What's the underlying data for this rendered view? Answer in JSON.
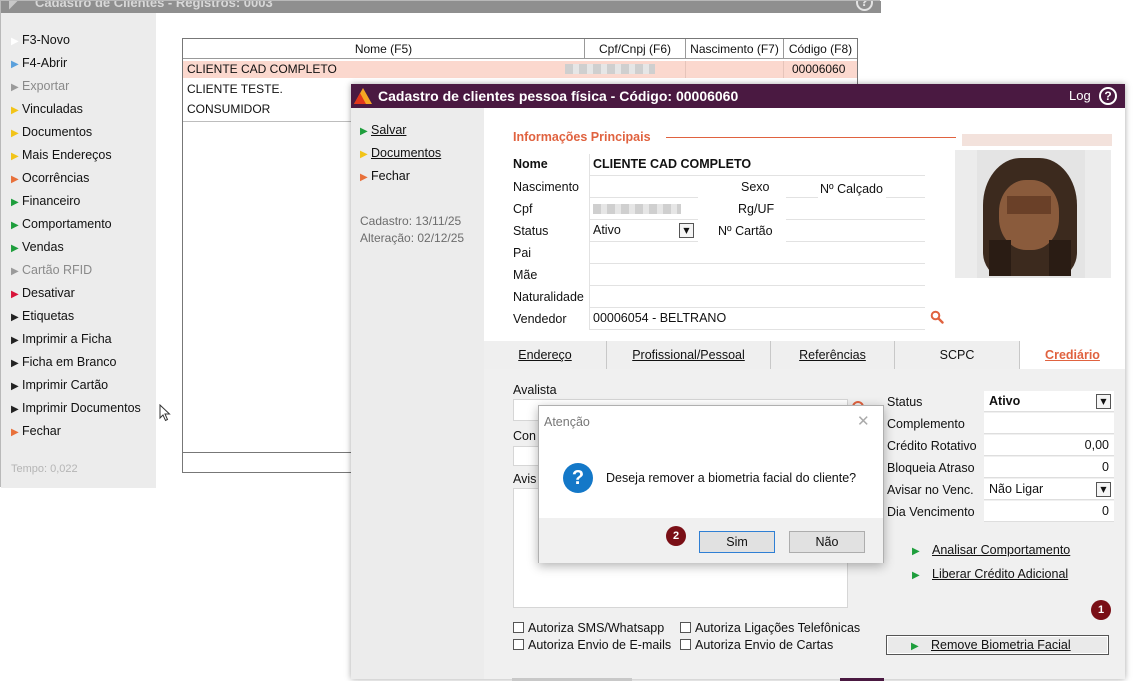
{
  "back_window": {
    "title": "Cadastro de Clientes - Registros: 0003",
    "help": "?",
    "sidebar": [
      {
        "label": "F3-Novo",
        "color": "#ffffff",
        "disabled": false
      },
      {
        "label": "F4-Abrir",
        "color": "#5aa0dc",
        "disabled": false
      },
      {
        "label": "Exportar",
        "color": "#9a9a9a",
        "disabled": true
      },
      {
        "label": "Vinculadas",
        "color": "#f2c418",
        "disabled": false
      },
      {
        "label": "Documentos",
        "color": "#f2c418",
        "disabled": false
      },
      {
        "label": "Mais Endereços",
        "color": "#f2c418",
        "disabled": false
      },
      {
        "label": "Ocorrências",
        "color": "#e8703a",
        "disabled": false
      },
      {
        "label": "Financeiro",
        "color": "#1e9e3c",
        "disabled": false
      },
      {
        "label": "Comportamento",
        "color": "#1e9e3c",
        "disabled": false
      },
      {
        "label": "Vendas",
        "color": "#1e9e3c",
        "disabled": false
      },
      {
        "label": "Cartão RFID",
        "color": "#9a9a9a",
        "disabled": true
      },
      {
        "label": "Desativar",
        "color": "#d8143a",
        "disabled": false
      },
      {
        "label": "Etiquetas",
        "color": "#222222",
        "disabled": false
      },
      {
        "label": "Imprimir a Ficha",
        "color": "#222222",
        "disabled": false
      },
      {
        "label": "Ficha em Branco",
        "color": "#222222",
        "disabled": false
      },
      {
        "label": "Imprimir Cartão",
        "color": "#222222",
        "disabled": false
      },
      {
        "label": "Imprimir Documentos",
        "color": "#222222",
        "disabled": false
      },
      {
        "label": "Fechar",
        "color": "#e8703a",
        "disabled": false
      }
    ],
    "tempo": "Tempo: 0,022",
    "grid": {
      "columns": [
        "Nome (F5)",
        "Cpf/Cnpj (F6)",
        "Nascimento (F7)",
        "Código (F8)"
      ],
      "rows": [
        {
          "nome": "CLIENTE CAD COMPLETO",
          "codigo": "00006060",
          "selected": true
        },
        {
          "nome": "CLIENTE TESTE.",
          "codigo": "",
          "selected": false
        },
        {
          "nome": "CONSUMIDOR",
          "codigo": "",
          "selected": false
        }
      ]
    }
  },
  "front_window": {
    "title": "Cadastro de clientes pessoa física - Código: 00006060",
    "log": "Log",
    "help": "?",
    "sidebar": [
      {
        "label": "Salvar",
        "color": "#1e9e3c"
      },
      {
        "label": "Documentos",
        "color": "#f2c418"
      },
      {
        "label": "Fechar",
        "color": "#e8703a"
      }
    ],
    "cadastro": "Cadastro: 13/11/25",
    "alteracao": "Alteração: 02/12/25",
    "section_title": "Informações Principais",
    "labels": {
      "nome": "Nome",
      "nascimento": "Nascimento",
      "sexo": "Sexo",
      "calcado": "Nº Calçado",
      "cpf": "Cpf",
      "rg": "Rg/UF",
      "status": "Status",
      "cartao": "Nº Cartão",
      "pai": "Pai",
      "mae": "Mãe",
      "naturalidade": "Naturalidade",
      "vendedor": "Vendedor"
    },
    "values": {
      "nome": "CLIENTE CAD COMPLETO",
      "status": "Ativo",
      "vendedor": "00006054 - BELTRANO"
    },
    "tabs": [
      "Endereço",
      "Profissional/Pessoal",
      "Referências",
      "SCPC",
      "Crediário"
    ],
    "crediario": {
      "avalista_label": "Avalista",
      "con_label": "Con",
      "avis_label": "Avis",
      "checks": [
        "Autoriza SMS/Whatsapp",
        "Autoriza Ligações Telefônicas",
        "Autoriza Envio de E-mails",
        "Autoriza Envio de Cartas"
      ],
      "right_labels": {
        "status": "Status",
        "complemento": "Complemento",
        "credito": "Crédito Rotativo",
        "bloqueia": "Bloqueia Atraso",
        "avisar": "Avisar no Venc.",
        "dia": "Dia Vencimento"
      },
      "right_values": {
        "status": "Ativo",
        "complemento": "",
        "credito": "0,00",
        "bloqueia": "0",
        "avisar": "Não Ligar",
        "dia": "0"
      },
      "links": [
        "Analisar Comportamento",
        "Liberar Crédito Adicional"
      ],
      "remove_button": "Remove Biometria Facial"
    }
  },
  "dialog": {
    "title": "Atenção",
    "message": "Deseja remover a biometria facial do cliente?",
    "yes": "Sim",
    "no": "Não"
  },
  "badges": [
    "1",
    "2"
  ],
  "colors": {
    "accent": "#e0623f",
    "title_bar": "#4a1941",
    "selected_row": "#fbd8ce",
    "badge": "#7a0f16"
  }
}
